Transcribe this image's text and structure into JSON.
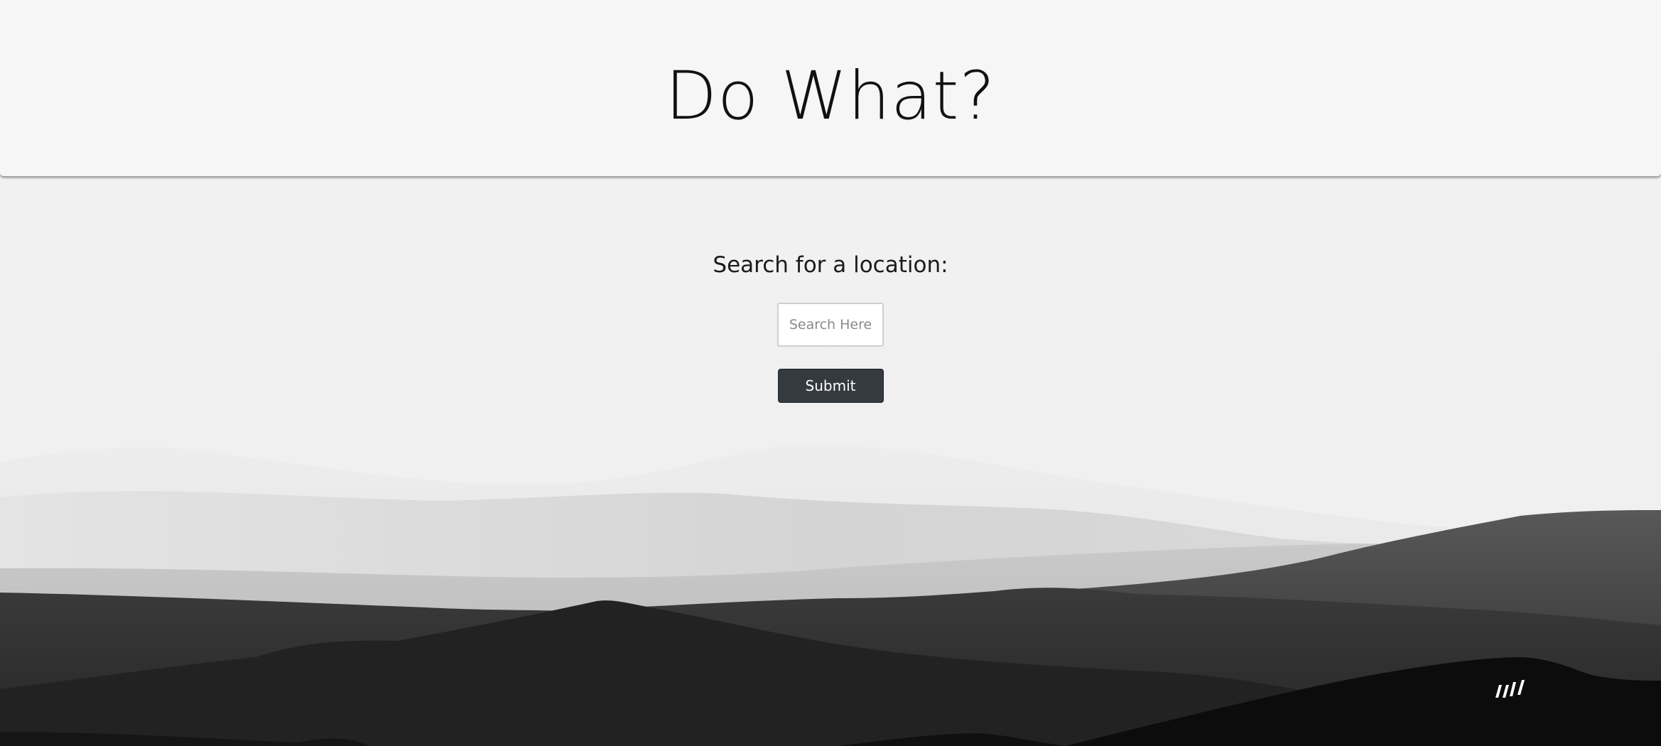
{
  "header": {
    "title": "Do What?"
  },
  "search": {
    "heading": "Search for a location:",
    "placeholder": "Search Here",
    "value": "",
    "submit_label": "Submit"
  },
  "icons": {
    "logo": "brand-slashes-logo-icon"
  },
  "colors": {
    "header_background": "#f6f6f6",
    "page_background": "#f1f1f1",
    "button_background": "#343a40",
    "button_text": "#ffffff"
  }
}
